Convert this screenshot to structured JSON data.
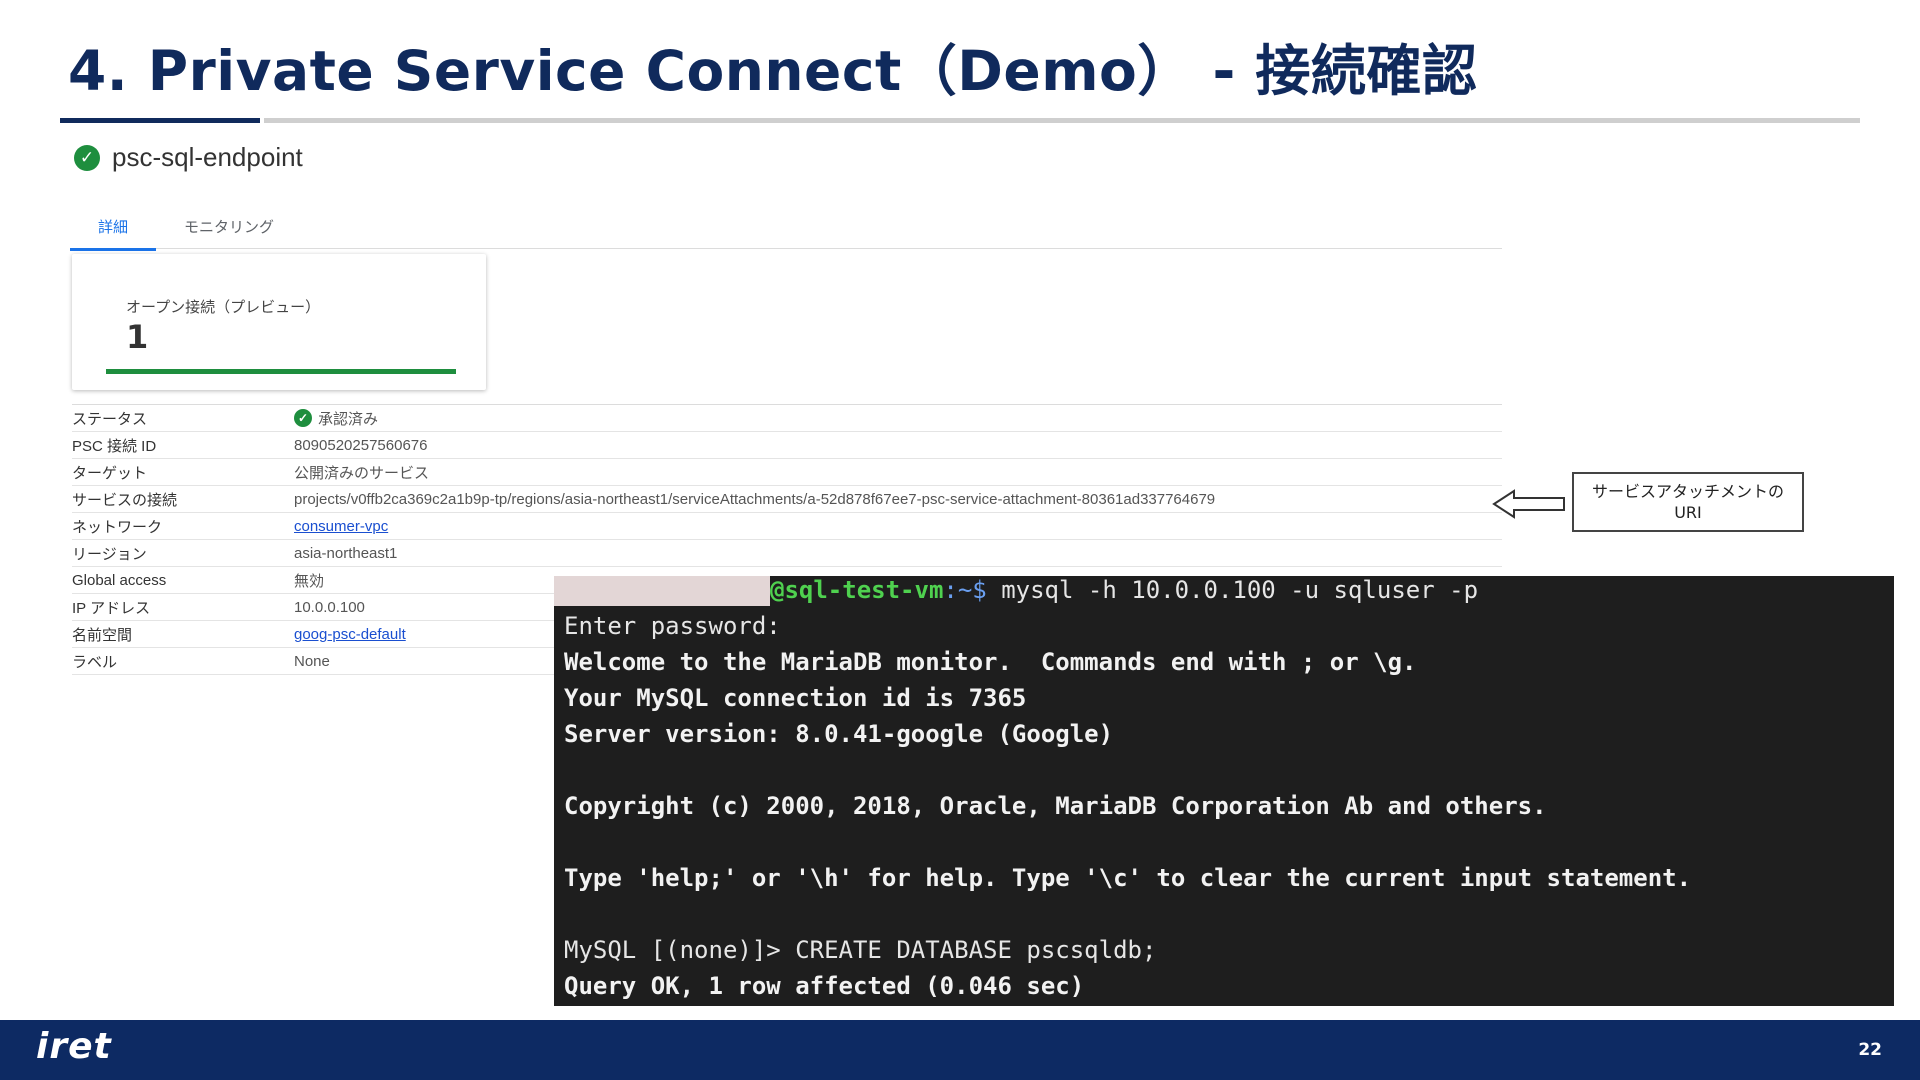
{
  "slide": {
    "title": "4. Private Service Connect（Demo） - 接続確認",
    "page_number": "22",
    "logo_text": "iret"
  },
  "console": {
    "endpoint_name": "psc-sql-endpoint",
    "tabs": [
      {
        "label": "詳細",
        "active": true
      },
      {
        "label": "モニタリング",
        "active": false
      }
    ],
    "metric": {
      "label": "オープン接続（プレビュー）",
      "value": "1",
      "fill_percent": 100
    },
    "properties": [
      {
        "key": "ステータス",
        "value": "承認済み",
        "type": "status"
      },
      {
        "key": "PSC 接続 ID",
        "value": "80905202575606​76",
        "type": "text"
      },
      {
        "key": "ターゲット",
        "value": "公開済みのサービス",
        "type": "text"
      },
      {
        "key": "サービスの接続",
        "value": "projects/v0ffb2ca369c2a1b9p-tp/regions/asia-northeast1/serviceAttachments/a-52d878f67ee7-psc-service-attachment-80361ad337764679",
        "type": "text"
      },
      {
        "key": "ネットワーク",
        "value": "consumer-vpc",
        "type": "link"
      },
      {
        "key": "リージョン",
        "value": "asia-northeast1",
        "type": "text"
      },
      {
        "key": "Global access",
        "value": "無効",
        "type": "text"
      },
      {
        "key": "IP アドレス",
        "value": "10.0.0.100",
        "type": "text"
      },
      {
        "key": "名前空間",
        "value": "goog-psc-default",
        "type": "link"
      },
      {
        "key": "ラベル",
        "value": "None",
        "type": "text"
      }
    ]
  },
  "callout": {
    "line1": "サービスアタッチメントの",
    "line2": "URI"
  },
  "terminal": {
    "prompt_host": "@sql-test-vm",
    "prompt_path": ":~$",
    "command": " mysql -h 10.0.0.100 -u sqluser -p",
    "lines": [
      "Enter password:",
      "Welcome to the MariaDB monitor.  Commands end with ; or \\g.",
      "Your MySQL connection id is 7365",
      "Server version: 8.0.41-google (Google)",
      "",
      "Copyright (c) 2000, 2018, Oracle, MariaDB Corporation Ab and others.",
      "",
      "Type 'help;' or '\\h' for help. Type '\\c' to clear the current input statement.",
      "",
      "MySQL [(none)]> CREATE DATABASE pscsqldb;",
      "Query OK, 1 row affected (0.046 sec)"
    ]
  },
  "colors": {
    "title": "#102a5c",
    "footer": "#0d2a63",
    "accent_green": "#1e8e3e",
    "link_blue": "#1a4fd0",
    "terminal_bg": "#1e1e1e"
  }
}
